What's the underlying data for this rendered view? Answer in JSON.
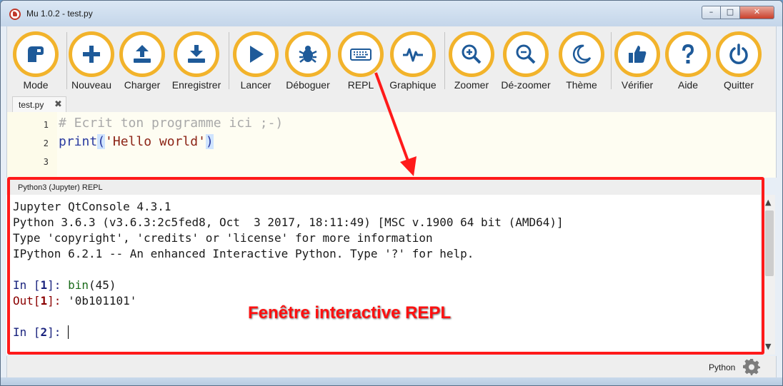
{
  "window": {
    "title": "Mu 1.0.2 - test.py",
    "minimize": "–",
    "maximize": "□",
    "close": "✕"
  },
  "toolbar": {
    "buttons": [
      {
        "label": "Mode",
        "icon": "mode-icon"
      },
      {
        "label": "Nouveau",
        "icon": "plus-icon"
      },
      {
        "label": "Charger",
        "icon": "upload-icon"
      },
      {
        "label": "Enregistrer",
        "icon": "download-icon"
      },
      {
        "label": "Lancer",
        "icon": "play-icon"
      },
      {
        "label": "Déboguer",
        "icon": "bug-icon"
      },
      {
        "label": "REPL",
        "icon": "keyboard-icon"
      },
      {
        "label": "Graphique",
        "icon": "plotter-icon"
      },
      {
        "label": "Zoomer",
        "icon": "zoom-in-icon"
      },
      {
        "label": "Dé-zoomer",
        "icon": "zoom-out-icon"
      },
      {
        "label": "Thème",
        "icon": "moon-icon"
      },
      {
        "label": "Vérifier",
        "icon": "thumbs-up-icon"
      },
      {
        "label": "Aide",
        "icon": "question-icon"
      },
      {
        "label": "Quitter",
        "icon": "power-icon"
      }
    ]
  },
  "tabs": [
    {
      "label": "test.py",
      "close": "✖"
    }
  ],
  "editor": {
    "line_numbers": [
      "1",
      "2",
      "3"
    ],
    "line1": "# Ecrit ton programme ici ;-)",
    "line2_fn": "print",
    "line2_open": "(",
    "line2_str": "'Hello world'",
    "line2_close": ")"
  },
  "repl": {
    "title": "Python3 (Jupyter) REPL",
    "banner": [
      "Jupyter QtConsole 4.3.1",
      "Python 3.6.3 (v3.6.3:2c5fed8, Oct  3 2017, 18:11:49) [MSC v.1900 64 bit (AMD64)]",
      "Type 'copyright', 'credits' or 'license' for more information",
      "IPython 6.2.1 -- An enhanced Interactive Python. Type '?' for help."
    ],
    "in1_prefix": "In [",
    "in1_num": "1",
    "in1_suffix": "]: ",
    "in1_code_fn": "bin",
    "in1_code_rest": "(45)",
    "out1_prefix": "Out[",
    "out1_num": "1",
    "out1_suffix": "]: ",
    "out1_value": "'0b101101'",
    "in2_prefix": "In [",
    "in2_num": "2",
    "in2_suffix": "]: "
  },
  "annotation": {
    "text": "Fenêtre interactive REPL",
    "color": "#ff1010"
  },
  "status": {
    "mode": "Python"
  },
  "colors": {
    "accent": "#f2b32b",
    "icon": "#1e5a99",
    "highlight": "#ff1a1a"
  }
}
